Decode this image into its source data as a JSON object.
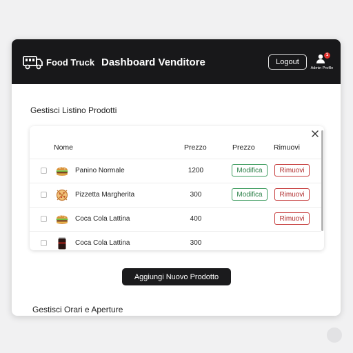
{
  "header": {
    "brand": "Food Truck",
    "title": "Dashboard Venditore",
    "logout_label": "Logout",
    "profile_label": "Admin Profile",
    "notification_count": "1"
  },
  "products_section": {
    "title": "Gestisci Listino Prodotti",
    "columns": [
      "Nome",
      "Prezzo",
      "Prezzo",
      "Rimuovi"
    ],
    "rows": [
      {
        "name": "Panino Normale",
        "price": "1200",
        "edit_label": "Modifica",
        "remove_label": "Rimuovi",
        "icon": "burger-icon"
      },
      {
        "name": "Pizzetta Margherita",
        "price": "300",
        "edit_label": "Modifica",
        "remove_label": "Rimuovi",
        "icon": "pizza-icon"
      },
      {
        "name": "Coca Cola Lattina",
        "price": "400",
        "remove_label": "Rimuovi",
        "icon": "burger-icon"
      },
      {
        "name": "Coca Cola Lattina",
        "price": "300",
        "icon": "cola-can-icon"
      }
    ],
    "add_button_label": "Aggiungi Nuovo Prodotto"
  },
  "hours_section": {
    "title": "Gestisci Orari e Aperture"
  },
  "colors": {
    "topbar": "#18181a",
    "edit_green": "#2b7f47",
    "remove_red": "#b02c2c",
    "badge_red": "#e0322e"
  }
}
